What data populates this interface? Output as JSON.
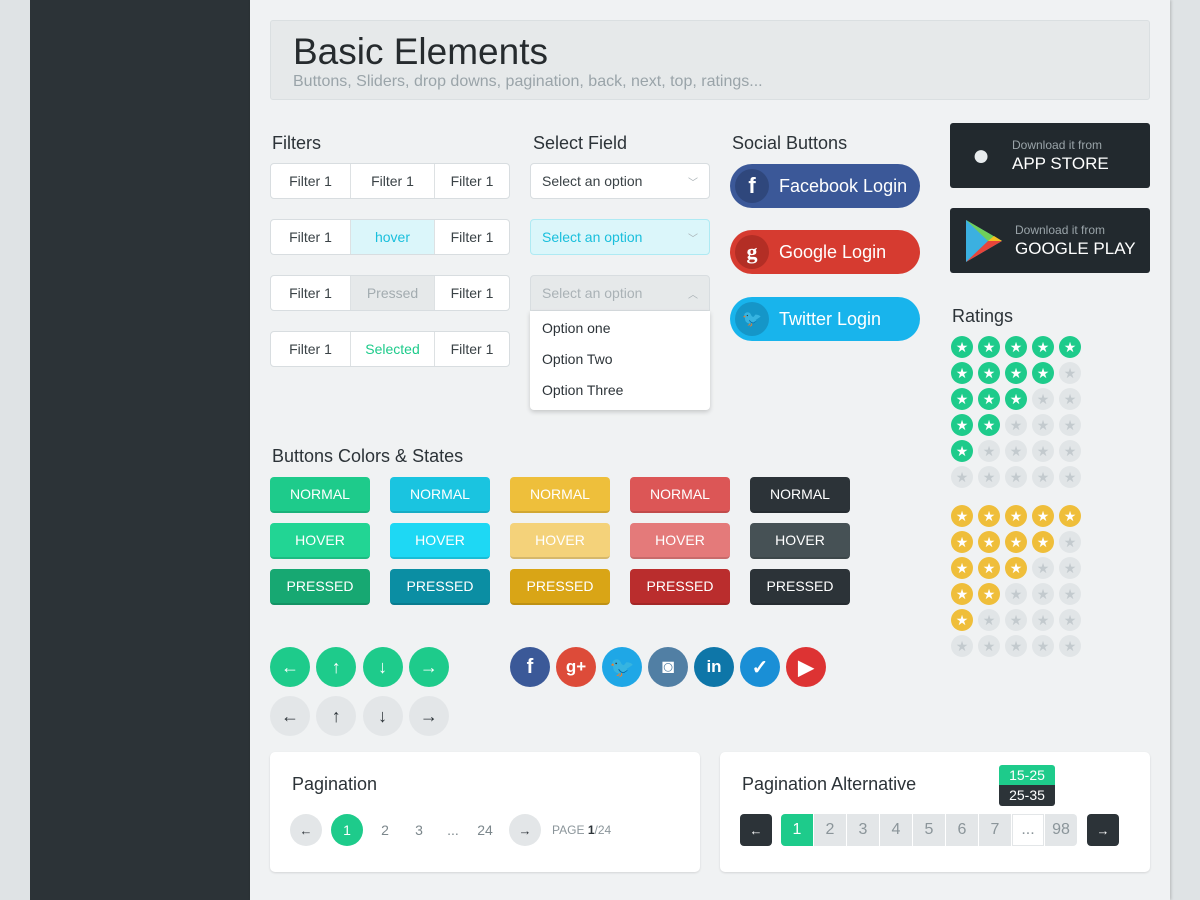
{
  "header": {
    "title": "Basic Elements",
    "subtitle": "Buttons, Sliders, drop downs, pagination, back, next, top, ratings..."
  },
  "filters": {
    "title": "Filters",
    "rows": [
      [
        "Filter 1",
        "Filter 1",
        "Filter 1"
      ],
      [
        "Filter 1",
        "hover",
        "Filter 1"
      ],
      [
        "Filter 1",
        "Pressed",
        "Filter 1"
      ],
      [
        "Filter 1",
        "Selected",
        "Filter 1"
      ]
    ]
  },
  "select": {
    "title": "Select Field",
    "placeholder": "Select an option",
    "options": [
      "Option one",
      "Option Two",
      "Option Three"
    ]
  },
  "social": {
    "title": "Social Buttons",
    "facebook": "Facebook Login",
    "google": "Google Login",
    "twitter": "Twitter Login"
  },
  "stores": {
    "apple_small": "Download it from",
    "apple_big": "APP STORE",
    "google_small": "Download it from",
    "google_big": "GOOGLE PLAY"
  },
  "ratings": {
    "title": "Ratings",
    "green": [
      5,
      4,
      3,
      2,
      1,
      0
    ],
    "yellow": [
      5,
      4,
      3,
      2,
      1,
      0
    ],
    "max": 5,
    "colors": {
      "green": "#1ecb8b",
      "yellow": "#efbe3a",
      "empty": "#e1e5e7"
    }
  },
  "buttons": {
    "title": "Buttons Colors & States",
    "states": [
      "NORMAL",
      "HOVER",
      "PRESSED"
    ],
    "colors": [
      [
        "#1ecb8b",
        "#22d594",
        "#17a872"
      ],
      [
        "#1ac4e0",
        "#1ed8f4",
        "#0b8ea3"
      ],
      [
        "#eebf3b",
        "#f4d27a",
        "#d9a516"
      ],
      [
        "#dc5656",
        "#e47a7a",
        "#ba2d2d"
      ],
      [
        "#2c3338",
        "#465155",
        "#2c3338"
      ]
    ]
  },
  "arrows": [
    "arrow-left",
    "arrow-up",
    "arrow-down",
    "arrow-right"
  ],
  "social_icons": [
    {
      "name": "facebook",
      "glyph": "f",
      "color": "#3b5998"
    },
    {
      "name": "google-plus",
      "glyph": "g+",
      "color": "#dd4b39"
    },
    {
      "name": "twitter",
      "glyph": "🐦",
      "color": "#1fa7e6"
    },
    {
      "name": "instagram",
      "glyph": "◙",
      "color": "#517fa4"
    },
    {
      "name": "linkedin",
      "glyph": "in",
      "color": "#0e76a8"
    },
    {
      "name": "forrst",
      "glyph": "✓",
      "color": "#1a8fd6"
    },
    {
      "name": "youtube",
      "glyph": "▶",
      "color": "#dd3333"
    }
  ],
  "pagination": {
    "title": "Pagination",
    "pages": [
      "1",
      "2",
      "3",
      "...",
      "24"
    ],
    "current": "1",
    "page_label": "PAGE",
    "page_current": "1",
    "page_total": "/24"
  },
  "pagination_alt": {
    "title": "Pagination Alternative",
    "pages": [
      "1",
      "2",
      "3",
      "4",
      "5",
      "6",
      "7",
      "...",
      "98"
    ],
    "current": "1",
    "tooltip": [
      "15-25",
      "25-35"
    ]
  }
}
